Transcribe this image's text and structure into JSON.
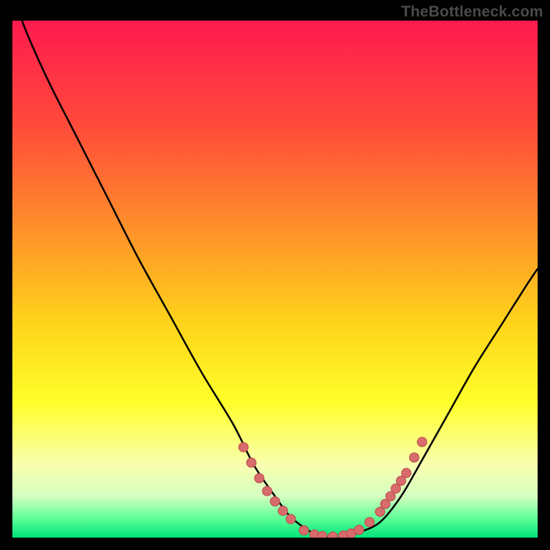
{
  "watermark": "TheBottleneck.com",
  "colors": {
    "background": "#000000",
    "curve": "#000000",
    "dot_fill": "#d86b6b",
    "dot_stroke": "#b94f4f",
    "gradient_stops": [
      {
        "offset": 0.0,
        "color": "#ff1a4f"
      },
      {
        "offset": 0.2,
        "color": "#ff4a3a"
      },
      {
        "offset": 0.4,
        "color": "#ff8f2a"
      },
      {
        "offset": 0.58,
        "color": "#ffd21a"
      },
      {
        "offset": 0.74,
        "color": "#ffff2a"
      },
      {
        "offset": 0.86,
        "color": "#f8ffb0"
      },
      {
        "offset": 0.92,
        "color": "#d4ffc0"
      },
      {
        "offset": 0.96,
        "color": "#66ff99"
      },
      {
        "offset": 1.0,
        "color": "#00e57a"
      }
    ]
  },
  "chart_data": {
    "type": "line",
    "title": "",
    "xlabel": "",
    "ylabel": "",
    "xlim": [
      0,
      100
    ],
    "ylim": [
      0,
      100
    ],
    "series": [
      {
        "name": "curve",
        "x": [
          0,
          3,
          7,
          12,
          18,
          24,
          30,
          36,
          42,
          46,
          50,
          53,
          57,
          60,
          63,
          66,
          70,
          74,
          78,
          83,
          88,
          93,
          98,
          100
        ],
        "y": [
          105,
          97,
          88,
          78,
          66,
          54,
          43,
          32,
          22,
          14,
          8,
          4,
          1,
          0,
          0,
          1,
          3,
          8,
          15,
          24,
          33,
          41,
          49,
          52
        ]
      }
    ],
    "dots": [
      {
        "x": 44.0,
        "y": 17.5
      },
      {
        "x": 45.5,
        "y": 14.5
      },
      {
        "x": 47.0,
        "y": 11.5
      },
      {
        "x": 48.5,
        "y": 9.0
      },
      {
        "x": 50.0,
        "y": 7.0
      },
      {
        "x": 51.5,
        "y": 5.2
      },
      {
        "x": 53.0,
        "y": 3.6
      },
      {
        "x": 55.5,
        "y": 1.4
      },
      {
        "x": 57.5,
        "y": 0.6
      },
      {
        "x": 59.0,
        "y": 0.3
      },
      {
        "x": 61.0,
        "y": 0.2
      },
      {
        "x": 63.0,
        "y": 0.4
      },
      {
        "x": 64.5,
        "y": 0.8
      },
      {
        "x": 66.0,
        "y": 1.5
      },
      {
        "x": 68.0,
        "y": 3.0
      },
      {
        "x": 70.0,
        "y": 5.0
      },
      {
        "x": 71.0,
        "y": 6.5
      },
      {
        "x": 72.0,
        "y": 8.0
      },
      {
        "x": 73.0,
        "y": 9.5
      },
      {
        "x": 74.0,
        "y": 11.0
      },
      {
        "x": 75.0,
        "y": 12.5
      },
      {
        "x": 76.5,
        "y": 15.5
      },
      {
        "x": 78.0,
        "y": 18.5
      }
    ]
  }
}
